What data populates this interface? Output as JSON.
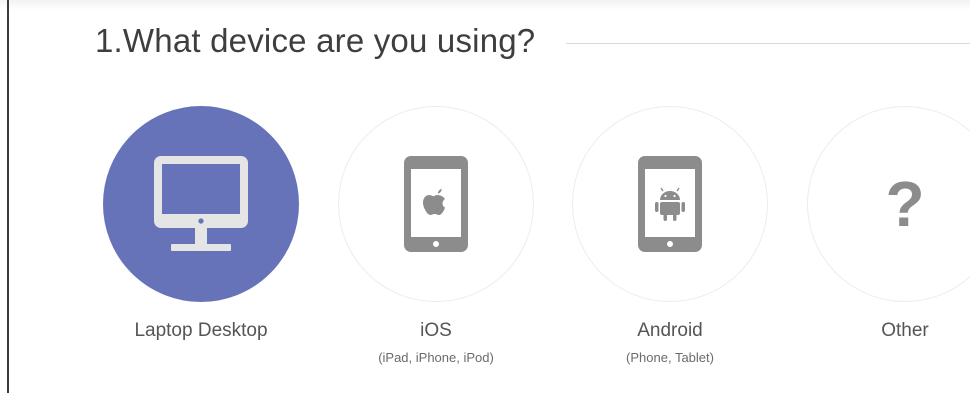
{
  "question": {
    "title": "1.What device are you using?"
  },
  "options": [
    {
      "label": "Laptop Desktop",
      "sublabel": "",
      "icon": "desktop-monitor-icon",
      "selected": true
    },
    {
      "label": "iOS",
      "sublabel": "(iPad, iPhone, iPod)",
      "icon": "ios-tablet-icon",
      "selected": false
    },
    {
      "label": "Android",
      "sublabel": "(Phone, Tablet)",
      "icon": "android-tablet-icon",
      "selected": false
    },
    {
      "label": "Other",
      "sublabel": "",
      "icon": "question-mark-icon",
      "selected": false
    }
  ],
  "other_icon_glyph": "?",
  "colors": {
    "selected": "#6673b8",
    "icon_gray": "#8c8c8c",
    "text": "#555555"
  }
}
